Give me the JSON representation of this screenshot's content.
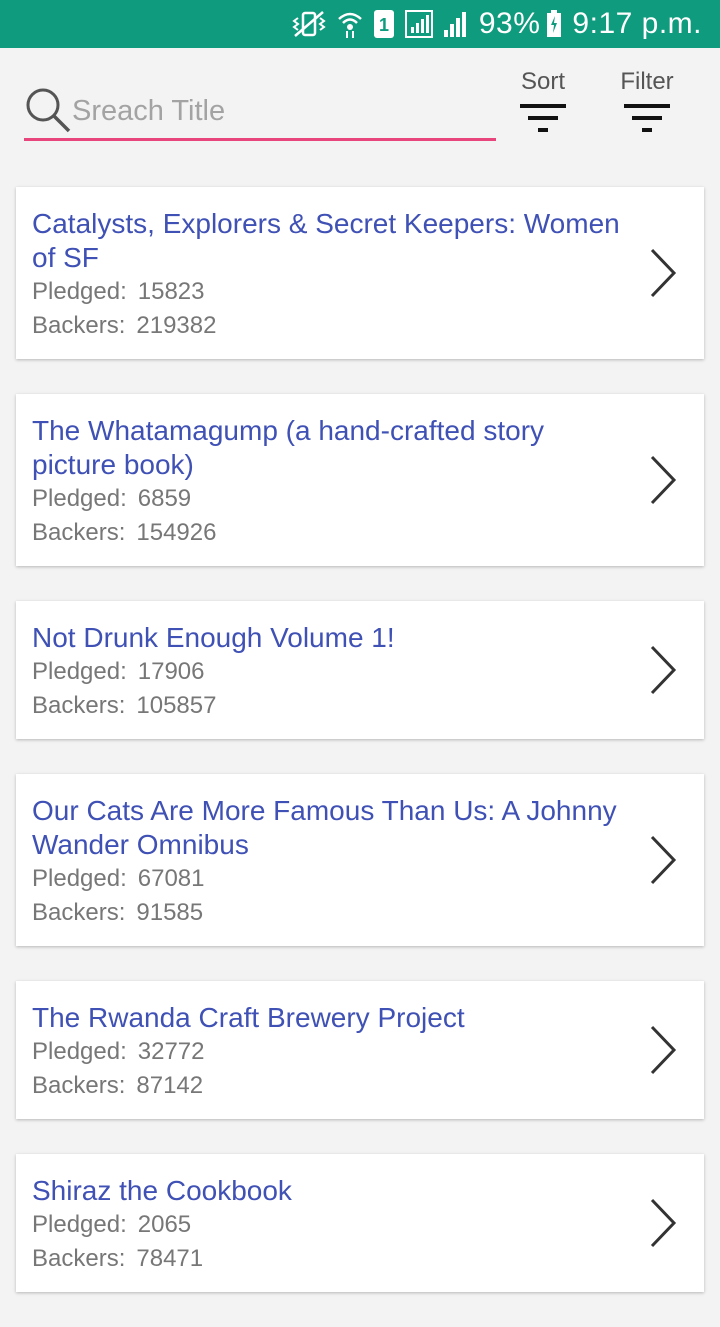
{
  "status_bar": {
    "battery": "93%",
    "time": "9:17 p.m.",
    "sim_badge": "1",
    "icons": [
      "vibrate-icon",
      "wifi-icon",
      "sim-icon",
      "signal-icon",
      "battery-icon"
    ],
    "bg_color": "#0f9b7e"
  },
  "toolbar": {
    "search_placeholder": "Sreach Title",
    "sort_label": "Sort",
    "filter_label": "Filter",
    "accent_color": "#e8457d"
  },
  "projects": [
    {
      "title": "Catalysts, Explorers & Secret Keepers: Women of SF",
      "pledged_label": "Pledged:",
      "pledged": "15823",
      "backers_label": "Backers:",
      "backers": "219382"
    },
    {
      "title": "The Whatamagump (a hand-crafted story picture book)",
      "pledged_label": "Pledged:",
      "pledged": "6859",
      "backers_label": "Backers:",
      "backers": "154926"
    },
    {
      "title": "Not Drunk Enough Volume 1!",
      "pledged_label": "Pledged:",
      "pledged": "17906",
      "backers_label": "Backers:",
      "backers": "105857"
    },
    {
      "title": "Our Cats Are More Famous Than Us: A Johnny Wander Omnibus",
      "pledged_label": "Pledged:",
      "pledged": "67081",
      "backers_label": "Backers:",
      "backers": "91585"
    },
    {
      "title": "The Rwanda Craft Brewery Project",
      "pledged_label": "Pledged:",
      "pledged": "32772",
      "backers_label": "Backers:",
      "backers": "87142"
    },
    {
      "title": "Shiraz the Cookbook",
      "pledged_label": "Pledged:",
      "pledged": "2065",
      "backers_label": "Backers:",
      "backers": "78471"
    }
  ]
}
